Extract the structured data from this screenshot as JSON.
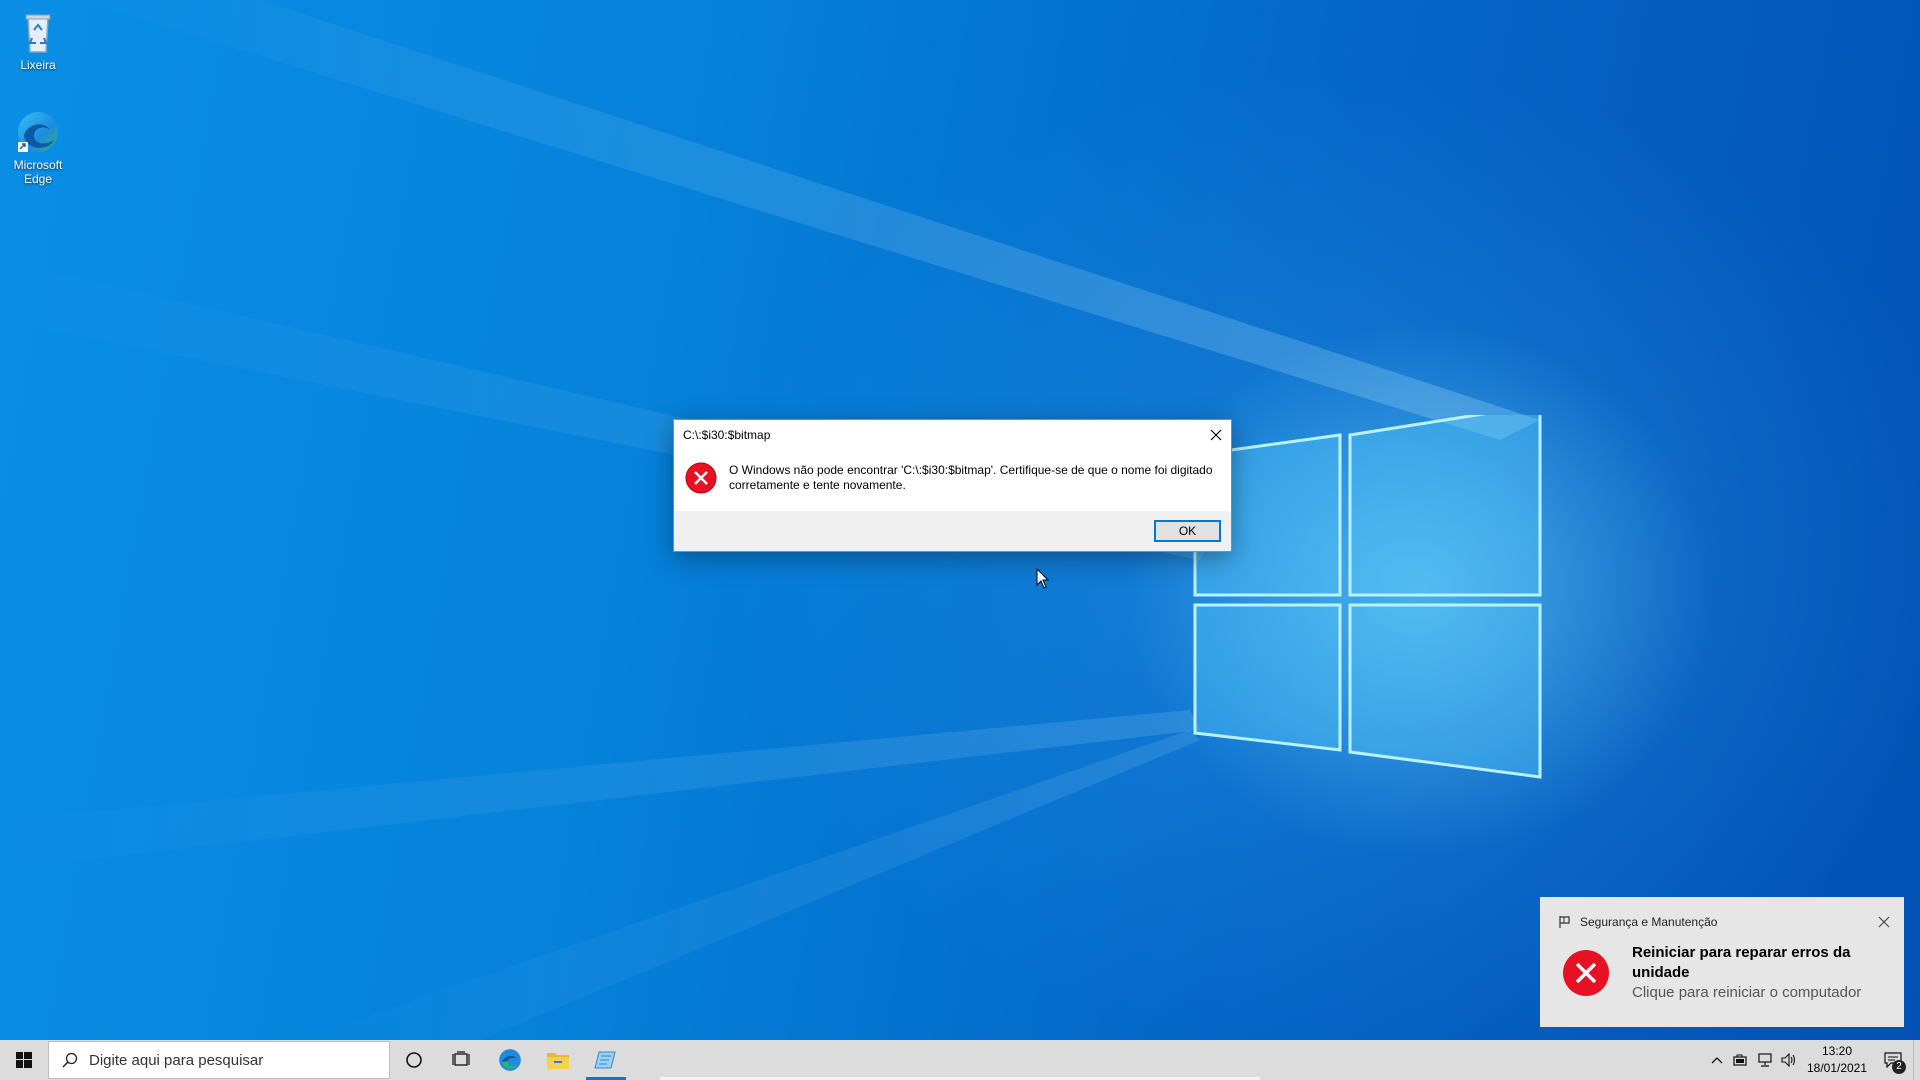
{
  "desktop": {
    "icons": [
      {
        "label": "Lixeira",
        "icon": "recycle-bin-icon"
      },
      {
        "label": "Microsoft Edge",
        "icon": "edge-icon"
      }
    ]
  },
  "dialog": {
    "title": "C:\\:$i30:$bitmap",
    "message": "O Windows não pode encontrar 'C:\\:$i30:$bitmap'. Certifique-se de que o nome foi digitado corretamente e tente novamente.",
    "ok_label": "OK",
    "icon": "error-icon"
  },
  "toast": {
    "app_name": "Segurança e Manutenção",
    "title": "Reiniciar para reparar erros da unidade",
    "subtitle": "Clique para reiniciar o computador",
    "icon": "error-icon"
  },
  "taskbar": {
    "search_placeholder": "Digite aqui para pesquisar",
    "apps": [
      "cortana-icon",
      "task-view-icon",
      "edge-icon",
      "file-explorer-icon",
      "notepad-icon"
    ],
    "clock": {
      "time": "13:20",
      "date": "18/01/2021"
    },
    "notification_count": "2"
  },
  "colors": {
    "accent": "#0078d7",
    "error_red": "#e81123",
    "desktop_blue": "#0581da"
  }
}
